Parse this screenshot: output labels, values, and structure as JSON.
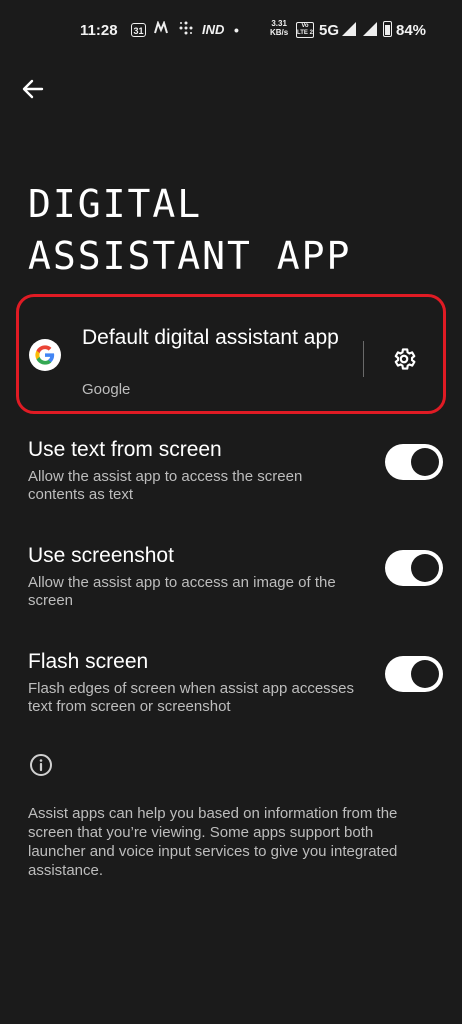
{
  "status_bar": {
    "time": "11:28",
    "calendar_day": "31",
    "carrier_text": "IND",
    "dot": "•",
    "speed_value": "3.31",
    "speed_unit": "KB/s",
    "volte_top": "Vo",
    "volte_bottom": "LTE 2",
    "network": "5G",
    "battery_percent": "84%",
    "icons": [
      "calendar-icon",
      "notification-icon",
      "grid-icon",
      "signal-icon",
      "wifi-icon",
      "battery-icon"
    ]
  },
  "header": {
    "back_icon": "arrow-left-icon",
    "title_line1": "DIGITAL",
    "title_line2": "ASSISTANT APP"
  },
  "default_assistant": {
    "title": "Default digital assistant app",
    "value": "Google",
    "app_icon": "google-g-icon",
    "settings_icon": "gear-icon",
    "highlight_color": "#e01b24"
  },
  "settings": [
    {
      "title": "Use text from screen",
      "description": "Allow the assist app to access the screen contents as text",
      "enabled": true
    },
    {
      "title": "Use screenshot",
      "description": "Allow the assist app to access an image of the screen",
      "enabled": true
    },
    {
      "title": "Flash screen",
      "description": "Flash edges of screen when assist app accesses text from screen or screenshot",
      "enabled": true
    }
  ],
  "footer": {
    "info_icon": "info-icon",
    "text": "Assist apps can help you based on information from the screen that you’re viewing. Some apps support both launcher and voice input services to give you integrated assistance."
  },
  "colors": {
    "background": "#1b1b1b",
    "text_primary": "#ffffff",
    "text_secondary": "#bdbdbd",
    "toggle_on": "#ffffff"
  }
}
